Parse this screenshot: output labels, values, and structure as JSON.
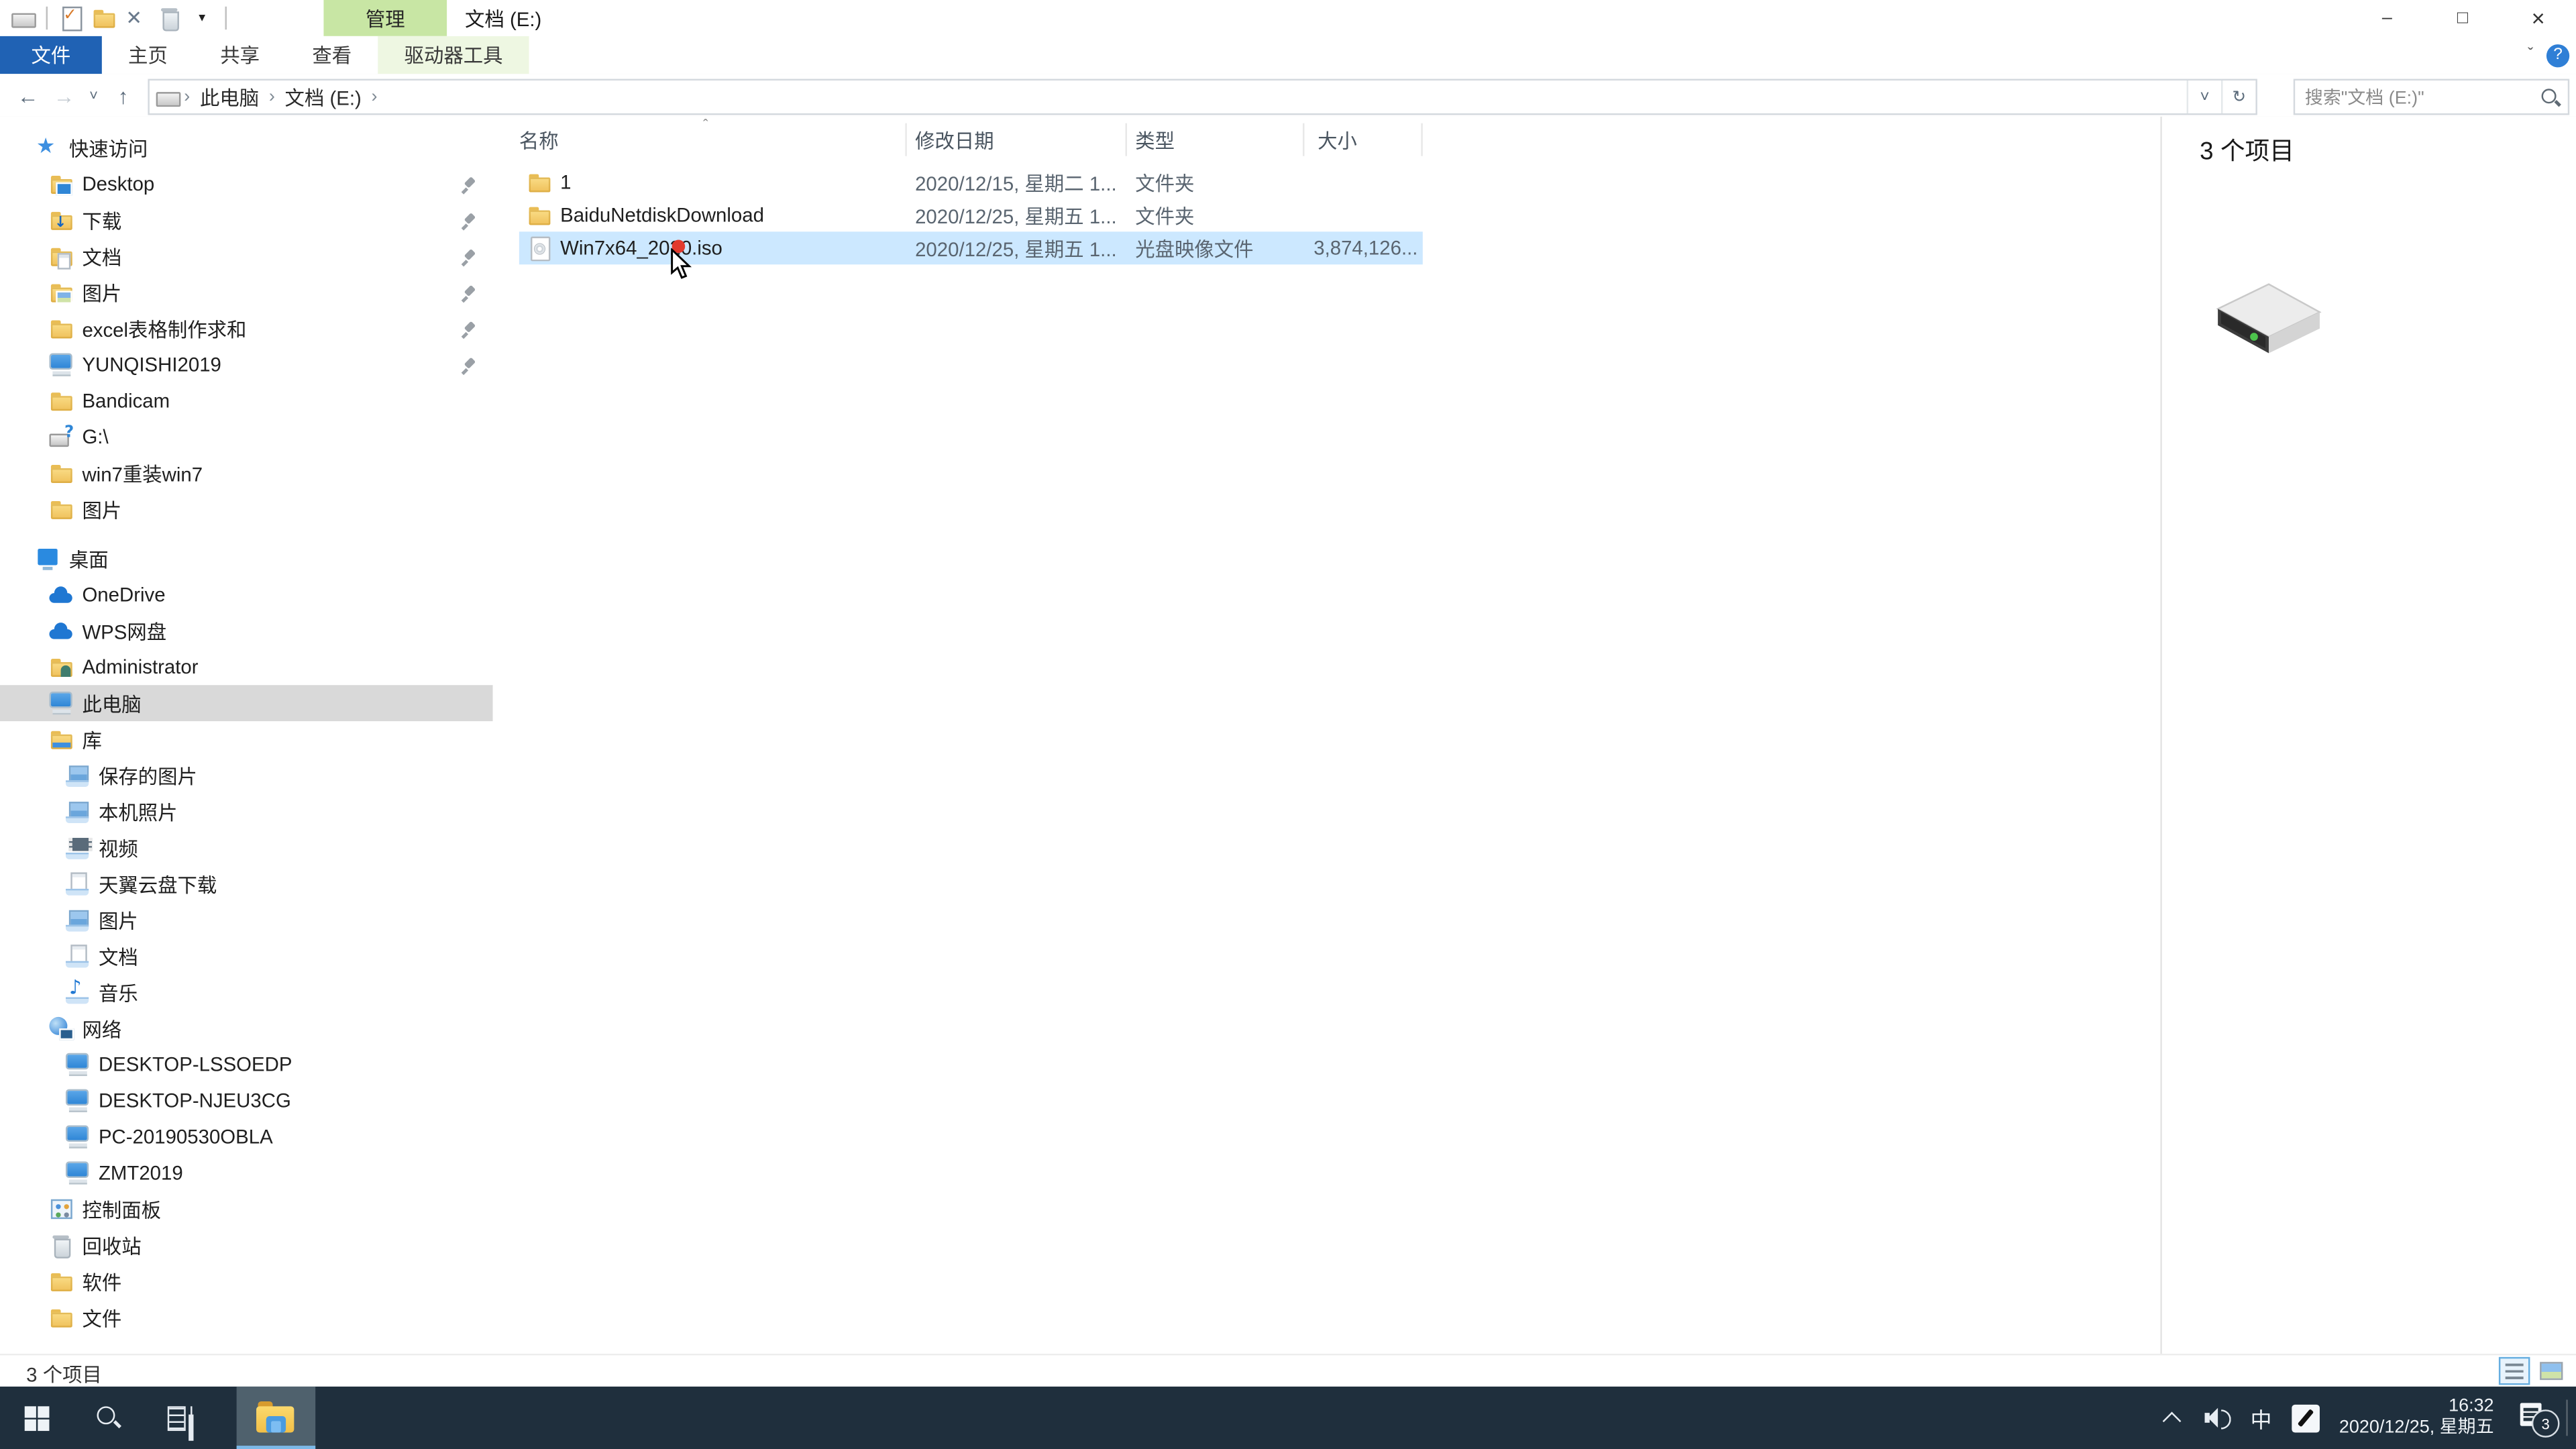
{
  "window": {
    "title": "文档 (E:)",
    "contextual_group": "管理",
    "caption": {
      "minimize": "–",
      "maximize": "□",
      "close": "×"
    }
  },
  "ribbon": {
    "tabs": [
      "文件",
      "主页",
      "共享",
      "查看",
      "驱动器工具"
    ],
    "expand_icon": "ˇ",
    "help_icon": "?"
  },
  "address_bar": {
    "nav": {
      "back": "←",
      "forward": "→",
      "recent": "˅",
      "up": "↑"
    },
    "crumb_chevron": "›",
    "crumbs": [
      "此电脑",
      "文档 (E:)"
    ],
    "dropdown": "˅",
    "refresh": "↻",
    "search_placeholder": "搜索\"文档 (E:)\""
  },
  "sidebar": {
    "items": [
      {
        "label": "快速访问"
      },
      {
        "label": "Desktop"
      },
      {
        "label": "下载"
      },
      {
        "label": "文档"
      },
      {
        "label": "图片"
      },
      {
        "label": "excel表格制作求和"
      },
      {
        "label": "YUNQISHI2019"
      },
      {
        "label": "Bandicam"
      },
      {
        "label": "G:\\"
      },
      {
        "label": "win7重装win7"
      },
      {
        "label": "图片"
      },
      {
        "label": "桌面"
      },
      {
        "label": "OneDrive"
      },
      {
        "label": "WPS网盘"
      },
      {
        "label": "Administrator"
      },
      {
        "label": "此电脑"
      },
      {
        "label": "库"
      },
      {
        "label": "保存的图片"
      },
      {
        "label": "本机照片"
      },
      {
        "label": "视频"
      },
      {
        "label": "天翼云盘下载"
      },
      {
        "label": "图片"
      },
      {
        "label": "文档"
      },
      {
        "label": "音乐"
      },
      {
        "label": "网络"
      },
      {
        "label": "DESKTOP-LSSOEDP"
      },
      {
        "label": "DESKTOP-NJEU3CG"
      },
      {
        "label": "PC-20190530OBLA"
      },
      {
        "label": "ZMT2019"
      },
      {
        "label": "控制面板"
      },
      {
        "label": "回收站"
      },
      {
        "label": "软件"
      },
      {
        "label": "文件"
      }
    ]
  },
  "file_list": {
    "sort_indicator": "ˆ",
    "columns": [
      "名称",
      "修改日期",
      "类型",
      "大小"
    ],
    "rows": [
      {
        "name": "1",
        "date": "2020/12/15, 星期二 1...",
        "type": "文件夹",
        "size": ""
      },
      {
        "name": "BaiduNetdiskDownload",
        "date": "2020/12/25, 星期五 1...",
        "type": "文件夹",
        "size": ""
      },
      {
        "name": "Win7x64_2020.iso",
        "date": "2020/12/25, 星期五 1...",
        "type": "光盘映像文件",
        "size": "3,874,126..."
      }
    ]
  },
  "preview_pane": {
    "item_count": "3 个项目"
  },
  "status_bar": {
    "item_count": "3 个项目"
  },
  "taskbar": {
    "ime_indicator": "中",
    "clock_time": "16:32",
    "clock_date": "2020/12/25, 星期五",
    "notification_badge": "3"
  }
}
